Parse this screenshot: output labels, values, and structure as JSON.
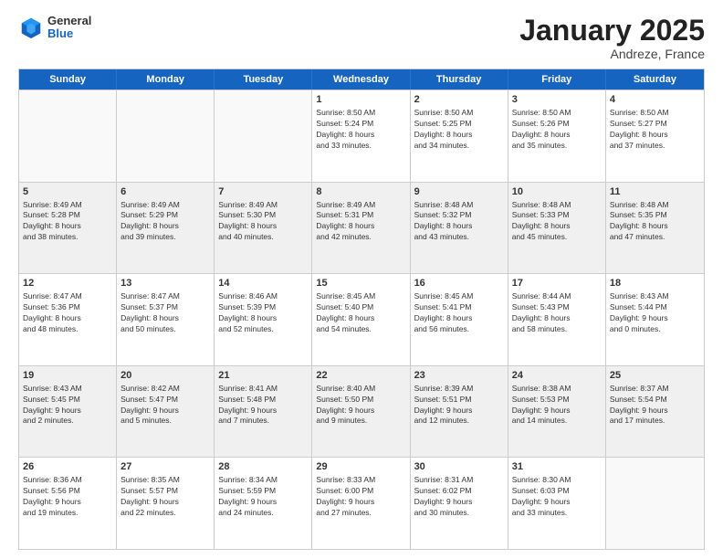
{
  "header": {
    "logo_general": "General",
    "logo_blue": "Blue",
    "month_title": "January 2025",
    "subtitle": "Andreze, France"
  },
  "weekdays": [
    "Sunday",
    "Monday",
    "Tuesday",
    "Wednesday",
    "Thursday",
    "Friday",
    "Saturday"
  ],
  "rows": [
    [
      {
        "day": "",
        "lines": []
      },
      {
        "day": "",
        "lines": []
      },
      {
        "day": "",
        "lines": []
      },
      {
        "day": "1",
        "lines": [
          "Sunrise: 8:50 AM",
          "Sunset: 5:24 PM",
          "Daylight: 8 hours",
          "and 33 minutes."
        ]
      },
      {
        "day": "2",
        "lines": [
          "Sunrise: 8:50 AM",
          "Sunset: 5:25 PM",
          "Daylight: 8 hours",
          "and 34 minutes."
        ]
      },
      {
        "day": "3",
        "lines": [
          "Sunrise: 8:50 AM",
          "Sunset: 5:26 PM",
          "Daylight: 8 hours",
          "and 35 minutes."
        ]
      },
      {
        "day": "4",
        "lines": [
          "Sunrise: 8:50 AM",
          "Sunset: 5:27 PM",
          "Daylight: 8 hours",
          "and 37 minutes."
        ]
      }
    ],
    [
      {
        "day": "5",
        "lines": [
          "Sunrise: 8:49 AM",
          "Sunset: 5:28 PM",
          "Daylight: 8 hours",
          "and 38 minutes."
        ]
      },
      {
        "day": "6",
        "lines": [
          "Sunrise: 8:49 AM",
          "Sunset: 5:29 PM",
          "Daylight: 8 hours",
          "and 39 minutes."
        ]
      },
      {
        "day": "7",
        "lines": [
          "Sunrise: 8:49 AM",
          "Sunset: 5:30 PM",
          "Daylight: 8 hours",
          "and 40 minutes."
        ]
      },
      {
        "day": "8",
        "lines": [
          "Sunrise: 8:49 AM",
          "Sunset: 5:31 PM",
          "Daylight: 8 hours",
          "and 42 minutes."
        ]
      },
      {
        "day": "9",
        "lines": [
          "Sunrise: 8:48 AM",
          "Sunset: 5:32 PM",
          "Daylight: 8 hours",
          "and 43 minutes."
        ]
      },
      {
        "day": "10",
        "lines": [
          "Sunrise: 8:48 AM",
          "Sunset: 5:33 PM",
          "Daylight: 8 hours",
          "and 45 minutes."
        ]
      },
      {
        "day": "11",
        "lines": [
          "Sunrise: 8:48 AM",
          "Sunset: 5:35 PM",
          "Daylight: 8 hours",
          "and 47 minutes."
        ]
      }
    ],
    [
      {
        "day": "12",
        "lines": [
          "Sunrise: 8:47 AM",
          "Sunset: 5:36 PM",
          "Daylight: 8 hours",
          "and 48 minutes."
        ]
      },
      {
        "day": "13",
        "lines": [
          "Sunrise: 8:47 AM",
          "Sunset: 5:37 PM",
          "Daylight: 8 hours",
          "and 50 minutes."
        ]
      },
      {
        "day": "14",
        "lines": [
          "Sunrise: 8:46 AM",
          "Sunset: 5:39 PM",
          "Daylight: 8 hours",
          "and 52 minutes."
        ]
      },
      {
        "day": "15",
        "lines": [
          "Sunrise: 8:45 AM",
          "Sunset: 5:40 PM",
          "Daylight: 8 hours",
          "and 54 minutes."
        ]
      },
      {
        "day": "16",
        "lines": [
          "Sunrise: 8:45 AM",
          "Sunset: 5:41 PM",
          "Daylight: 8 hours",
          "and 56 minutes."
        ]
      },
      {
        "day": "17",
        "lines": [
          "Sunrise: 8:44 AM",
          "Sunset: 5:43 PM",
          "Daylight: 8 hours",
          "and 58 minutes."
        ]
      },
      {
        "day": "18",
        "lines": [
          "Sunrise: 8:43 AM",
          "Sunset: 5:44 PM",
          "Daylight: 9 hours",
          "and 0 minutes."
        ]
      }
    ],
    [
      {
        "day": "19",
        "lines": [
          "Sunrise: 8:43 AM",
          "Sunset: 5:45 PM",
          "Daylight: 9 hours",
          "and 2 minutes."
        ]
      },
      {
        "day": "20",
        "lines": [
          "Sunrise: 8:42 AM",
          "Sunset: 5:47 PM",
          "Daylight: 9 hours",
          "and 5 minutes."
        ]
      },
      {
        "day": "21",
        "lines": [
          "Sunrise: 8:41 AM",
          "Sunset: 5:48 PM",
          "Daylight: 9 hours",
          "and 7 minutes."
        ]
      },
      {
        "day": "22",
        "lines": [
          "Sunrise: 8:40 AM",
          "Sunset: 5:50 PM",
          "Daylight: 9 hours",
          "and 9 minutes."
        ]
      },
      {
        "day": "23",
        "lines": [
          "Sunrise: 8:39 AM",
          "Sunset: 5:51 PM",
          "Daylight: 9 hours",
          "and 12 minutes."
        ]
      },
      {
        "day": "24",
        "lines": [
          "Sunrise: 8:38 AM",
          "Sunset: 5:53 PM",
          "Daylight: 9 hours",
          "and 14 minutes."
        ]
      },
      {
        "day": "25",
        "lines": [
          "Sunrise: 8:37 AM",
          "Sunset: 5:54 PM",
          "Daylight: 9 hours",
          "and 17 minutes."
        ]
      }
    ],
    [
      {
        "day": "26",
        "lines": [
          "Sunrise: 8:36 AM",
          "Sunset: 5:56 PM",
          "Daylight: 9 hours",
          "and 19 minutes."
        ]
      },
      {
        "day": "27",
        "lines": [
          "Sunrise: 8:35 AM",
          "Sunset: 5:57 PM",
          "Daylight: 9 hours",
          "and 22 minutes."
        ]
      },
      {
        "day": "28",
        "lines": [
          "Sunrise: 8:34 AM",
          "Sunset: 5:59 PM",
          "Daylight: 9 hours",
          "and 24 minutes."
        ]
      },
      {
        "day": "29",
        "lines": [
          "Sunrise: 8:33 AM",
          "Sunset: 6:00 PM",
          "Daylight: 9 hours",
          "and 27 minutes."
        ]
      },
      {
        "day": "30",
        "lines": [
          "Sunrise: 8:31 AM",
          "Sunset: 6:02 PM",
          "Daylight: 9 hours",
          "and 30 minutes."
        ]
      },
      {
        "day": "31",
        "lines": [
          "Sunrise: 8:30 AM",
          "Sunset: 6:03 PM",
          "Daylight: 9 hours",
          "and 33 minutes."
        ]
      },
      {
        "day": "",
        "lines": []
      }
    ]
  ]
}
